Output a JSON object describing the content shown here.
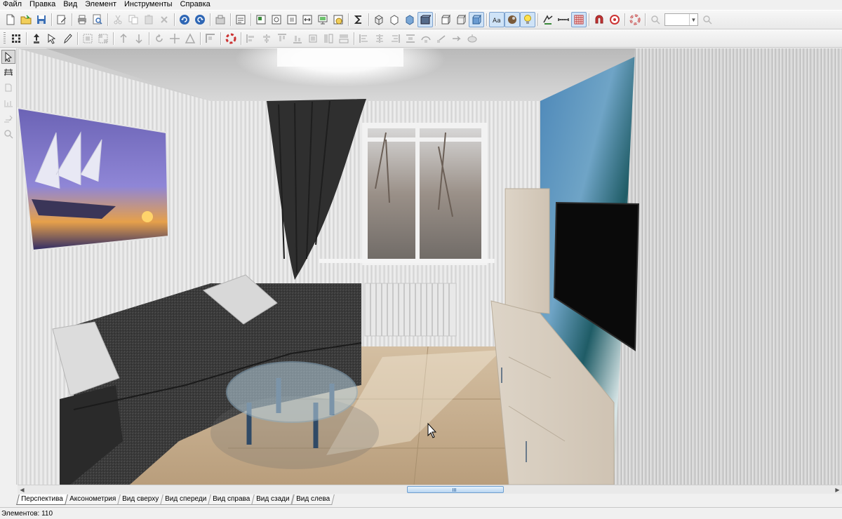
{
  "menu": {
    "items": [
      "Файл",
      "Правка",
      "Вид",
      "Элемент",
      "Инструменты",
      "Справка"
    ]
  },
  "toolbar1": {
    "buttons": [
      "new-file-icon",
      "open-folder-icon",
      "save-icon",
      "edit-properties-icon",
      "print-icon",
      "print-preview-icon",
      "cut-icon",
      "copy-icon",
      "paste-icon",
      "delete-icon",
      "undo-icon",
      "redo-icon",
      "catalog-icon",
      "project-properties-icon",
      "plan-icon",
      "wall-view-icon",
      "dimension-icon",
      "export-icon",
      "render-icon",
      "sum-icon",
      "view-box-1-icon",
      "view-box-2-icon",
      "view-box-3-icon",
      "view-box-4-icon",
      "view-box-5-icon",
      "view-box-6-icon",
      "view-box-7-icon",
      "text-label-icon",
      "materials-icon",
      "light-bulb-icon",
      "walls-icon",
      "ruler-icon",
      "grid-icon",
      "magnet-icon",
      "target-icon",
      "lifebuoy-icon",
      "zoom-out-icon",
      "zoom-in-icon"
    ],
    "zoom_value": ""
  },
  "toolbar2": {
    "buttons": [
      "snap-grid-icon",
      "move-up-icon",
      "move-cursor-icon",
      "pencil-icon",
      "select-group-icon",
      "ungroup-icon",
      "rotate-left-icon",
      "rotate-right-icon",
      "rotate-icon",
      "move-icon",
      "mirror-icon",
      "align-corner-icon",
      "lifebuoy-icon",
      "align-1-icon",
      "align-2-icon",
      "align-3-icon",
      "align-4-icon",
      "align-5-icon",
      "align-6-icon",
      "align-7-icon",
      "distribute-1-icon",
      "distribute-2-icon",
      "distribute-3-icon",
      "distribute-4-icon",
      "distribute-5-icon",
      "distribute-6-icon",
      "distribute-7-icon",
      "distribute-8-icon"
    ]
  },
  "left_tools": [
    "pointer-icon",
    "rays-icon",
    "object-icon",
    "dimension-tool-icon",
    "edit-tool-icon",
    "zoom-tool-icon"
  ],
  "tabs": [
    "Перспектива",
    "Аксонометрия",
    "Вид сверху",
    "Вид спереди",
    "Вид справа",
    "Вид сзади",
    "Вид слева"
  ],
  "active_tab": 0,
  "status": {
    "elements_label": "Элементов: 110"
  },
  "colors": {
    "accent": "#7da2ce",
    "sofa": "#3a3a3a",
    "floor": "#c9b293",
    "wall": "#e2e2e2"
  }
}
